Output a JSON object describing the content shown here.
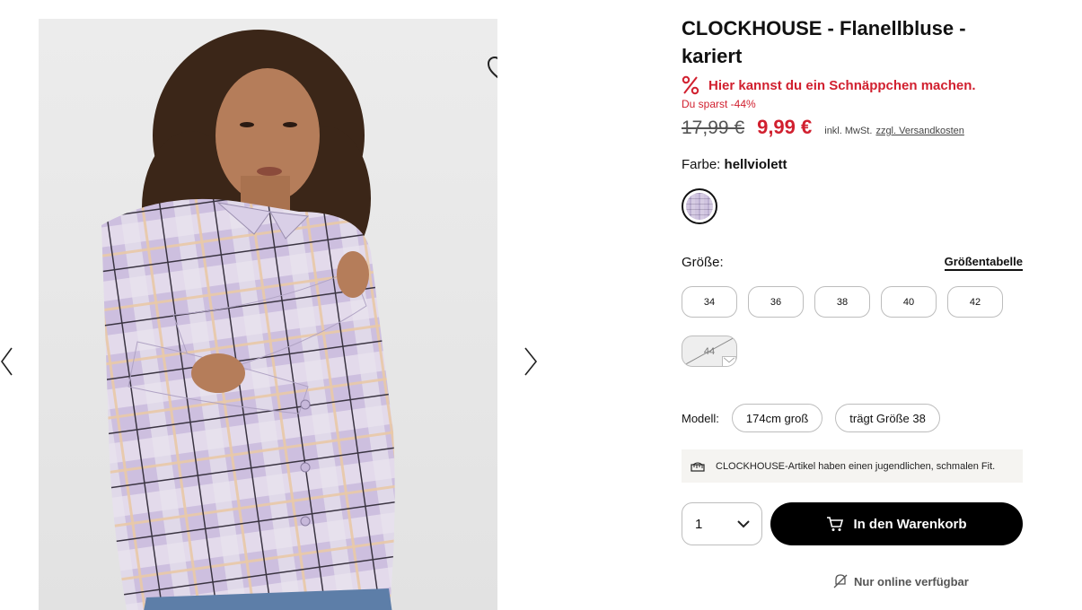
{
  "gallery": {
    "prev_icon": "chevron-left-icon",
    "next_icon": "chevron-right-icon",
    "wishlist_icon": "heart-icon",
    "image_alt": "Model wearing lilac plaid flannel blouse"
  },
  "product": {
    "title": "CLOCKHOUSE - Flanellbluse - kariert",
    "deal_text": "Hier kannst du ein Schnäppchen machen.",
    "savings_text": "Du sparst -44%",
    "old_price": "17,99 €",
    "new_price": "9,99 €",
    "tax_note": "inkl. MwSt.",
    "shipping_link": "zzgl. Versandkosten"
  },
  "color": {
    "label": "Farbe:",
    "value": "hellviolett"
  },
  "size": {
    "label": "Größe:",
    "chart_link": "Größentabelle",
    "options": [
      {
        "label": "34",
        "available": true
      },
      {
        "label": "36",
        "available": true
      },
      {
        "label": "38",
        "available": true
      },
      {
        "label": "40",
        "available": true
      },
      {
        "label": "42",
        "available": true
      },
      {
        "label": "44",
        "available": false
      }
    ]
  },
  "model": {
    "label": "Modell:",
    "height": "174cm groß",
    "size_worn": "trägt Größe 38"
  },
  "fit_note": "CLOCKHOUSE-Artikel haben einen jugendlichen, schmalen Fit.",
  "cart": {
    "quantity": "1",
    "button_label": "In den Warenkorb"
  },
  "availability": "Nur online verfügbar",
  "colors": {
    "sale_red": "#d1202f",
    "button_black": "#000000"
  }
}
